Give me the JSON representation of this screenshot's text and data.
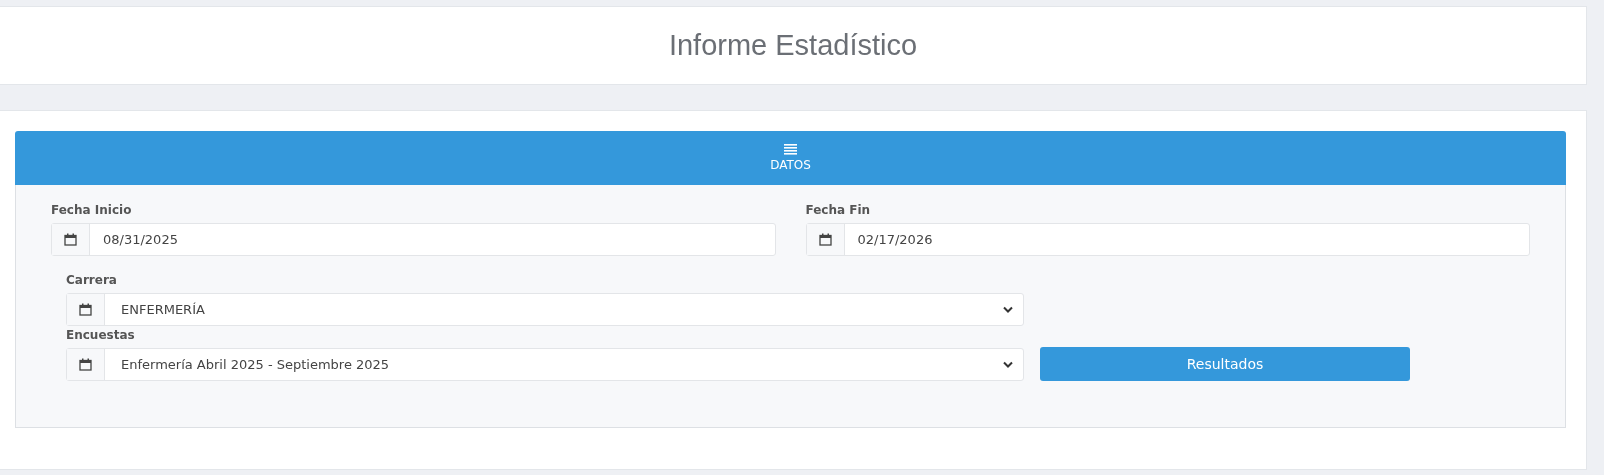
{
  "header": {
    "title": "Informe Estadístico"
  },
  "panel": {
    "title": "DATOS"
  },
  "dates": [
    {
      "label": "Fecha Inicio",
      "value": "08/31/2025"
    },
    {
      "label": "Fecha Fin",
      "value": "02/17/2026"
    }
  ],
  "selects": [
    {
      "label": "Carrera",
      "value": "ENFERMERÍA"
    },
    {
      "label": "Encuestas",
      "value": "Enfermería Abril 2025 - Septiembre 2025"
    }
  ],
  "button": {
    "label": "Resultados"
  }
}
